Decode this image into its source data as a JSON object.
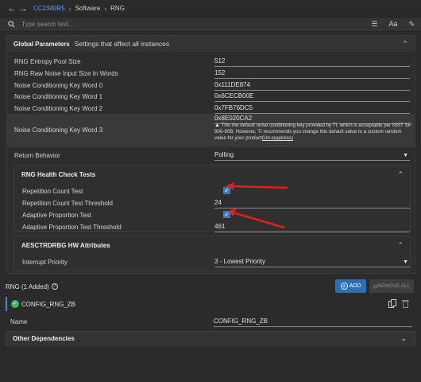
{
  "nav": {
    "back": "←",
    "forward": "→",
    "device": "CC2340R5",
    "crumbs": [
      "Software",
      "RNG"
    ]
  },
  "search": {
    "placeholder": "Type search text...",
    "icons": [
      "list-icon",
      "text-size-icon",
      "pin-icon"
    ],
    "text_size_label": "Aa"
  },
  "global_params": {
    "title": "Global Parameters",
    "description": "Settings that affect all instances",
    "rows": [
      {
        "label": "RNG Entropy Pool Size",
        "value": "512"
      },
      {
        "label": "RNG Raw Noise Input Size In Words",
        "value": "152"
      },
      {
        "label": "Noise Conditioning Key Word 0",
        "value": "0x111DE874"
      },
      {
        "label": "Noise Conditioning Key Word 1",
        "value": "0x6CECB00E"
      },
      {
        "label": "Noise Conditioning Key Word 2",
        "value": "0x7FB76DC5"
      },
      {
        "label": "Noise Conditioning Key Word 3",
        "value": "0x8E020CA2"
      }
    ],
    "warning": {
      "text": "This the default noise conditioning key provided by TI, which is acceptable per NIST SP 800-90B. However, TI recommends you change this default value to a custom random value for your product",
      "link": "(Un-suppress)"
    },
    "return_behavior": {
      "label": "Return Behavior",
      "value": "Polling"
    }
  },
  "health_tests": {
    "title": "RNG Health Check Tests",
    "rows": [
      {
        "label": "Repetition Count Test",
        "checked": true
      },
      {
        "label": "Repetition Count Test Threshold",
        "value": "24"
      },
      {
        "label": "Adaptive Proportion Test",
        "checked": true
      },
      {
        "label": "Adaptive Proportion Test Threshold",
        "value": "461"
      }
    ]
  },
  "hw_attributes": {
    "title": "AESCTRDRBG HW Attributes",
    "interrupt_priority": {
      "label": "Interrupt Priority",
      "value": "3 - Lowest Priority"
    }
  },
  "rng_list": {
    "title": "RNG (1 Added)",
    "help": "?",
    "add_label": "ADD",
    "remove_label": "REMOVE ALL",
    "instance_name": "CONFIG_RNG_ZB",
    "name_label": "Name",
    "name_value": "CONFIG_RNG_ZB"
  },
  "other_dependencies": {
    "title": "Other Dependencies"
  },
  "colors": {
    "accent": "#2f7fd9",
    "annotation": "#e0201b",
    "valid": "#46b35f"
  }
}
